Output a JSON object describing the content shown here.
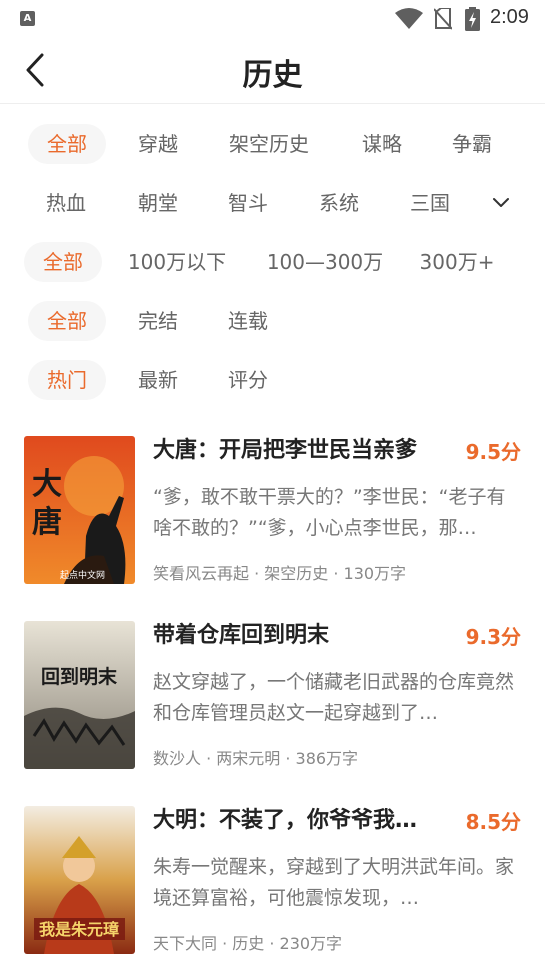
{
  "status_bar": {
    "left_icon_letter": "A",
    "time": "2:09"
  },
  "header": {
    "title": "历史"
  },
  "filters": {
    "categories": [
      "全部",
      "穿越",
      "架空历史",
      "谋略",
      "争霸",
      "热血",
      "朝堂",
      "智斗",
      "系统",
      "三国"
    ],
    "word_counts": [
      "全部",
      "100万以下",
      "100—300万",
      "300万+"
    ],
    "status": [
      "全部",
      "完结",
      "连载"
    ],
    "sort": [
      "热门",
      "最新",
      "评分"
    ]
  },
  "books": [
    {
      "title": "大唐：开局把李世民当亲爹",
      "score": "9.5分",
      "description": "“爹，敢不敢干票大的？”李世民：“老子有啥不敢的？”“爹，小心点李世民，那…",
      "meta": "笑看风云再起 · 架空历史 · 130万字",
      "cover_text": "大唐",
      "cover_publisher": "起点中文网"
    },
    {
      "title": "带着仓库回到明末",
      "score": "9.3分",
      "description": "赵文穿越了，一个储藏老旧武器的仓库竟然和仓库管理员赵文一起穿越到了…",
      "meta": "数沙人 · 两宋元明 · 386万字",
      "cover_text": "回到明末"
    },
    {
      "title": "大明：不装了，你爷爷我…",
      "score": "8.5分",
      "description": "朱寿一觉醒来，穿越到了大明洪武年间。家境还算富裕，可他震惊发现，…",
      "meta": "天下大同 · 历史 · 230万字",
      "cover_text": "我是朱元璋"
    }
  ]
}
